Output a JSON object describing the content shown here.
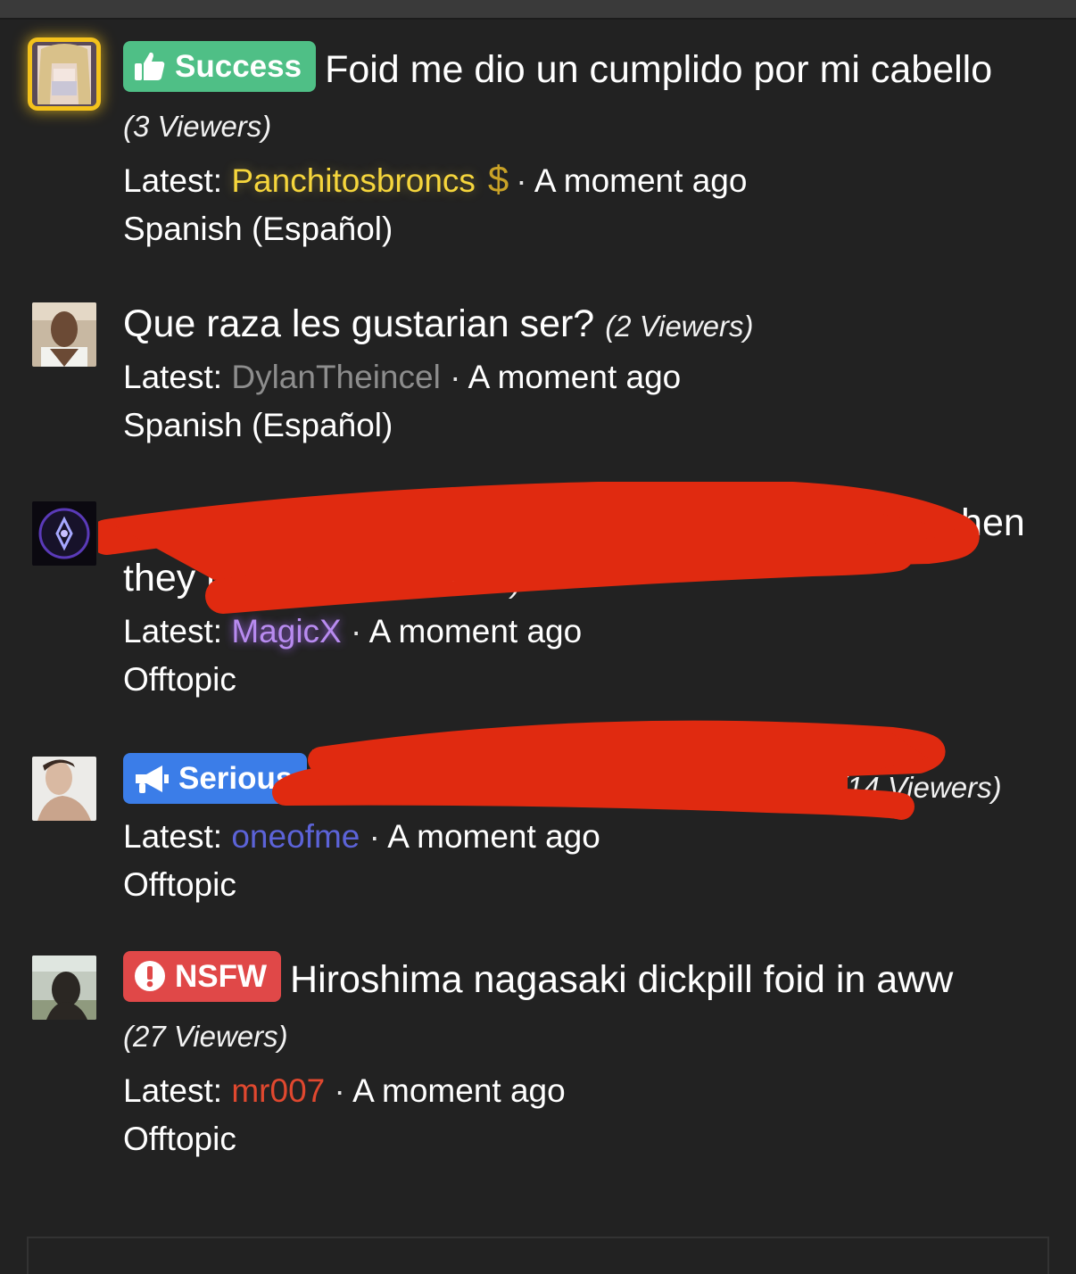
{
  "threads": [
    {
      "badge": {
        "label": "Success",
        "color": "#4fbf86",
        "icon": "thumbs-up-icon"
      },
      "title": "Foid me dio un cumplido por mi cabello",
      "viewers": "(3 Viewers)",
      "latest_label": "Latest:",
      "user": "Panchitosbroncs",
      "user_icon": "$",
      "time": "A moment ago",
      "forum": "Spanish (Español)"
    },
    {
      "title": "Que raza les gustarian ser?",
      "viewers": "(2 Viewers)",
      "latest_label": "Latest:",
      "user": "DylanTheincel",
      "time": "A moment ago",
      "forum": "Spanish (Español)"
    },
    {
      "title_visible_start": "they re",
      "title_visible_end": "when",
      "viewers": "(8 Viewers)",
      "latest_label": "Latest:",
      "user": "MagicX",
      "time": "A moment ago",
      "forum": "Offtopic"
    },
    {
      "badge": {
        "label": "Serious",
        "color": "#3b7de8",
        "icon": "megaphone-icon"
      },
      "viewers": "(14 Viewers)",
      "latest_label": "Latest:",
      "user": "oneofme",
      "time": "A moment ago",
      "forum": "Offtopic"
    },
    {
      "badge": {
        "label": "NSFW",
        "color": "#e04848",
        "icon": "exclamation-icon"
      },
      "title": "Hiroshima nagasaki dickpill foid in aww",
      "viewers": "(27 Viewers)",
      "latest_label": "Latest:",
      "user": "mr007",
      "time": "A moment ago",
      "forum": "Offtopic"
    }
  ],
  "separator": "·",
  "colors": {
    "background": "#222222",
    "user_gold": "#f6d63c",
    "user_grey": "#8d8d8d",
    "user_purple": "#b88bf0",
    "user_blue": "#5c63d8",
    "user_red": "#e0482f",
    "redaction": "#e02a10"
  }
}
